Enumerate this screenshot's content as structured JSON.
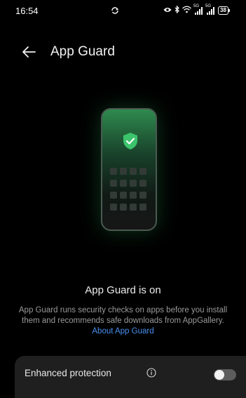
{
  "status_bar": {
    "time": "16:54",
    "battery": "38",
    "signal_1_label": "5G",
    "signal_2_label": "5G",
    "icons": [
      "sync-icon",
      "eye-icon",
      "bluetooth-icon",
      "wifi-icon",
      "signal-icon",
      "signal-icon",
      "battery-icon"
    ]
  },
  "header": {
    "title": "App Guard",
    "back_icon": "back-arrow-icon"
  },
  "illustration": {
    "icon": "shield-check-icon",
    "accent_color": "#3bc46b"
  },
  "main": {
    "status_heading": "App Guard is on",
    "description": "App Guard runs security checks on apps before you install them and recommends safe downloads from AppGallery.",
    "link_label": "About App Guard",
    "link_color": "#4a8ff0"
  },
  "settings": {
    "enhanced_protection": {
      "label": "Enhanced protection",
      "info_icon": "info-icon",
      "enabled": false
    }
  }
}
